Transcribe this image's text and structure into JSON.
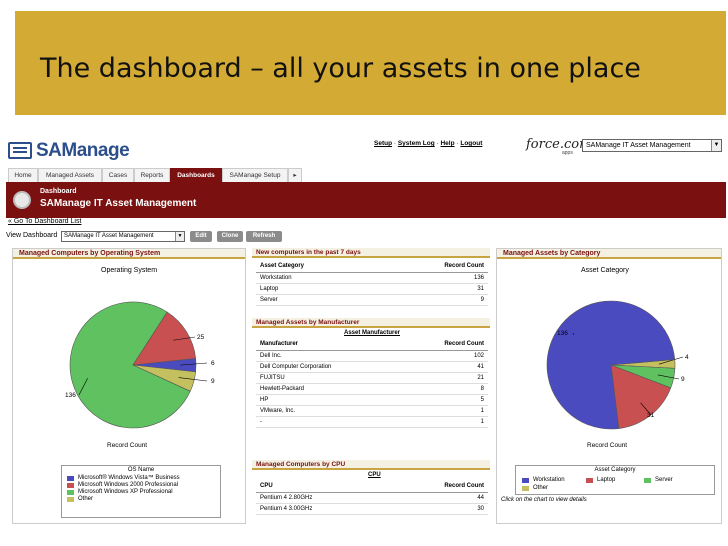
{
  "slide": {
    "title": "The dashboard – all your assets in one place"
  },
  "header": {
    "logo": "SAManage",
    "links": [
      "Setup",
      "System Log",
      "Help",
      "Logout"
    ],
    "force_logo": "force.com",
    "force_apps": "apps",
    "app_select": "SAManage IT Asset Management"
  },
  "tabs": [
    "Home",
    "Managed Assets",
    "Cases",
    "Reports",
    "Dashboards",
    "SAManage Setup",
    "▸"
  ],
  "active_tab": "Dashboards",
  "dashboard": {
    "label": "Dashboard",
    "name": "SAManage IT Asset Management",
    "back_link": "« Go To Dashboard List",
    "view_label": "View Dashboard",
    "view_select": "SAManage IT Asset Management",
    "buttons": {
      "edit": "Edit",
      "clone": "Clone",
      "refresh": "Refresh"
    }
  },
  "left_panel": {
    "header": "Managed Computers by Operating System",
    "chart_title": "Operating System",
    "x_label": "Record Count",
    "legend_title": "OS Name",
    "pie_labels": [
      "25",
      "6",
      "9",
      "136"
    ]
  },
  "middle_panel": {
    "header1": "New computers in the past 7 days",
    "table1": {
      "headers": [
        "Asset Category",
        "Record Count"
      ],
      "rows": [
        [
          "Workstation",
          "136"
        ],
        [
          "Laptop",
          "31"
        ],
        [
          "Server",
          "9"
        ]
      ]
    },
    "header2": "Managed Assets by Manufacturer",
    "table2_title": "Asset Manufacturer",
    "table2": {
      "headers": [
        "Manufacturer",
        "Record Count"
      ],
      "rows": [
        [
          "Dell Inc.",
          "102"
        ],
        [
          "Dell Computer Corporation",
          "41"
        ],
        [
          "FUJITSU",
          "21"
        ],
        [
          "Hewlett-Packard",
          "8"
        ],
        [
          "HP",
          "5"
        ],
        [
          "VMware, Inc.",
          "1"
        ],
        [
          "-",
          "1"
        ]
      ]
    },
    "header3": "Managed Computers by CPU",
    "table3_title": "CPU",
    "table3": {
      "headers": [
        "CPU",
        "Record Count"
      ],
      "rows": [
        [
          "Pentium 4 2.80GHz",
          "44"
        ],
        [
          "Pentium 4 3.00GHz",
          "30"
        ]
      ]
    }
  },
  "right_panel": {
    "header": "Managed Assets by Category",
    "chart_title": "Asset Category",
    "x_label": "Record Count",
    "legend_title": "Asset Category",
    "pie_labels": [
      "136",
      "4",
      "9",
      "31"
    ],
    "click_note": "Click on the chart to view details"
  },
  "chart_data": [
    {
      "type": "pie",
      "title": "Operating System",
      "xlabel": "Record Count",
      "legend_title": "OS Name",
      "categories": [
        "Microsoft® Windows Vista™ Business",
        "Microsoft Windows 2000 Professional",
        "Microsoft Windows XP Professional",
        "Other"
      ],
      "values": [
        6,
        25,
        136,
        9
      ],
      "colors": [
        "#4b4bc0",
        "#c85050",
        "#5fc15f",
        "#c4c060"
      ]
    },
    {
      "type": "pie",
      "title": "Asset Category",
      "xlabel": "Record Count",
      "legend_title": "Asset Category",
      "categories": [
        "Workstation",
        "Laptop",
        "Server",
        "Other"
      ],
      "values": [
        136,
        31,
        9,
        4
      ],
      "colors": [
        "#4b4bc0",
        "#c85050",
        "#5fc15f",
        "#c4c060"
      ]
    }
  ]
}
